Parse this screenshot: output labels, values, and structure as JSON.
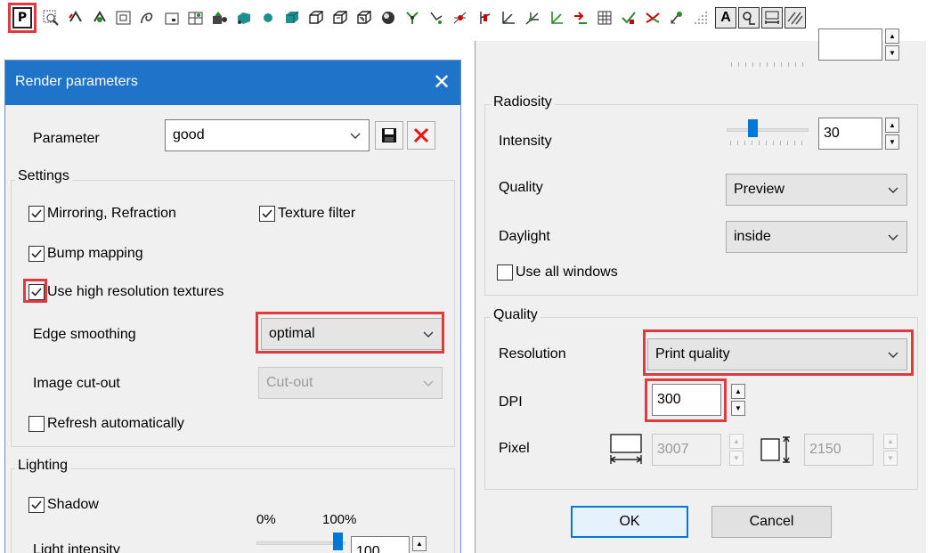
{
  "toolbar": {
    "p_label": "P",
    "icons": [
      "p-icon",
      "zoom-window-icon",
      "pan-icon",
      "rotate-view-icon",
      "zoom-extents-icon",
      "freehand-icon",
      "frame-icon",
      "grid-icon",
      "render-icon",
      "solid-icon",
      "sphere-icon",
      "cube-icon",
      "wireframe-icon",
      "hidden-line-icon",
      "ball-icon",
      "axis-icon",
      "angle-icon",
      "dimension-icon",
      "marker-icon",
      "coordinate-icon",
      "slope-icon",
      "xy-axis-icon",
      "arrow-icon",
      "table-icon",
      "check-icon",
      "merge-icon",
      "point-icon",
      "dots-icon",
      "text-a-icon",
      "text-magnifier-icon",
      "width-icon",
      "hatch-icon"
    ],
    "text_a_label": "A"
  },
  "left_dialog": {
    "title": "Render parameters",
    "close_glyph": "✕",
    "parameter_label": "Parameter",
    "parameter_value": "good",
    "settings": {
      "title": "Settings",
      "mirroring_label": "Mirroring, Refraction",
      "mirroring_checked": true,
      "texture_filter_label": "Texture filter",
      "texture_filter_checked": true,
      "bump_mapping_label": "Bump mapping",
      "bump_mapping_checked": true,
      "high_res_label": "Use high resolution textures",
      "high_res_checked": true,
      "edge_smoothing_label": "Edge smoothing",
      "edge_smoothing_value": "optimal",
      "image_cutout_label": "Image cut-out",
      "image_cutout_value": "Cut-out",
      "refresh_label": "Refresh automatically",
      "refresh_checked": false
    },
    "lighting": {
      "title": "Lighting",
      "shadow_label": "Shadow",
      "shadow_checked": true,
      "scale_min": "0%",
      "scale_max": "100%",
      "light_intensity_label": "Light intensity",
      "light_intensity_value": "100"
    }
  },
  "right_dialog": {
    "radiosity": {
      "title": "Radiosity",
      "intensity_label": "Intensity",
      "intensity_value": "30",
      "quality_label": "Quality",
      "quality_value": "Preview",
      "daylight_label": "Daylight",
      "daylight_value": "inside",
      "use_all_windows_label": "Use all windows",
      "use_all_windows_checked": false
    },
    "quality": {
      "title": "Quality",
      "resolution_label": "Resolution",
      "resolution_value": "Print quality",
      "dpi_label": "DPI",
      "dpi_value": "300",
      "pixel_label": "Pixel",
      "pixel_width": "3007",
      "pixel_height": "2150"
    },
    "ok_label": "OK",
    "cancel_label": "Cancel"
  },
  "colors": {
    "titlebar": "#1f73c8",
    "highlight": "#e0393e",
    "slider_thumb": "#0078d7"
  }
}
